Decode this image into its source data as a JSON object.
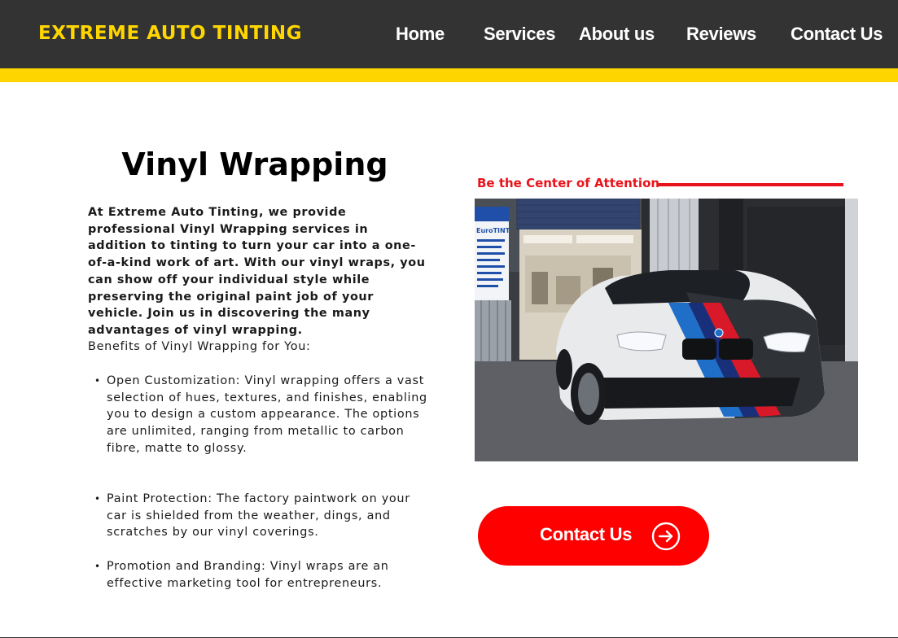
{
  "brand": {
    "name": "EXTREME AUTO TINTING",
    "color": "#ffd600"
  },
  "nav": {
    "items": [
      {
        "label": "Home"
      },
      {
        "label": "Services"
      },
      {
        "label": "About us"
      },
      {
        "label": "Reviews"
      },
      {
        "label": "Contact Us"
      }
    ]
  },
  "colors": {
    "header_bg": "#333333",
    "accent_yellow": "#ffd500",
    "accent_red": "#e8141c",
    "button_red": "#ff0000"
  },
  "main": {
    "title": "Vinyl Wrapping",
    "intro": "At Extreme Auto Tinting, we provide professional Vinyl Wrapping services in addition to tinting to turn your car into a one-of-a-kind work of art. With our vinyl wraps, you can show off your individual style while preserving the original paint job of your vehicle. Join us in discovering the many advantages of vinyl wrapping.",
    "benefits_heading": "Benefits of Vinyl Wrapping for You:",
    "benefits": [
      "Open Customization: Vinyl wrapping offers a vast selection of hues, textures, and finishes, enabling you to design a custom appearance. The options are unlimited, ranging from metallic to carbon fibre, matte to glossy.",
      "Paint Protection: The factory paintwork on your car is shielded from the weather, dings, and scratches by our vinyl coverings.",
      "Promotion and Branding: Vinyl wraps are an effective marketing tool for entrepreneurs."
    ],
    "bullet": "•"
  },
  "feature": {
    "tagline": "Be the Center of Attention",
    "image_icon": "car-photo",
    "sign_text": "EuroTINT"
  },
  "cta": {
    "label": "Contact Us",
    "icon": "arrow-right-circle-icon"
  }
}
